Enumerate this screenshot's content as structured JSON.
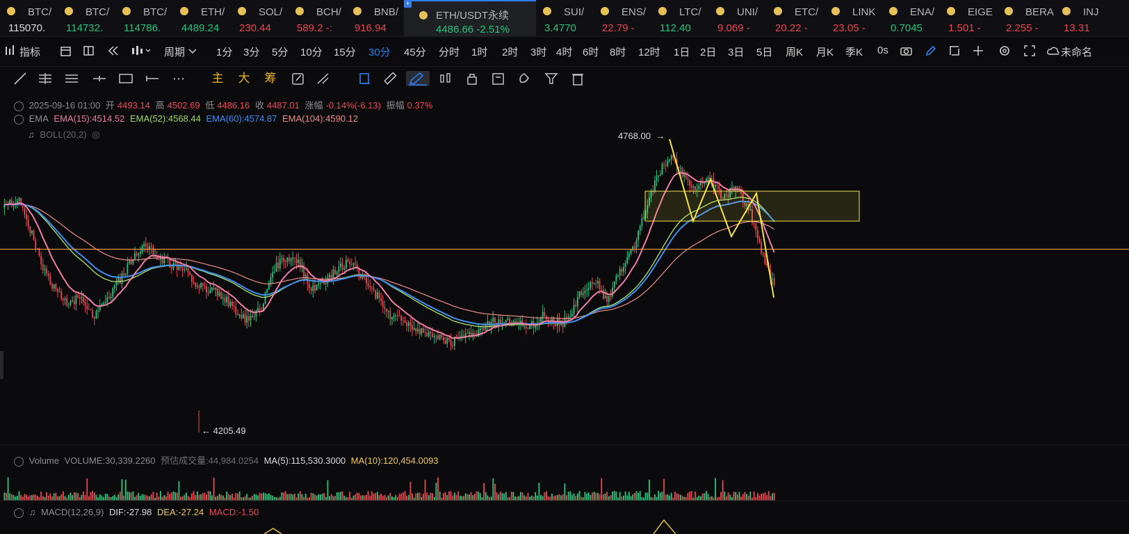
{
  "ticker": [
    {
      "sym": "BTC/",
      "price": "115070.",
      "cls": "wh"
    },
    {
      "sym": "BTC/",
      "price": "114732.",
      "cls": "up"
    },
    {
      "sym": "BTC/",
      "price": "114786.",
      "cls": "up"
    },
    {
      "sym": "ETH/",
      "price": "4489.24",
      "cls": "up"
    },
    {
      "sym": "SOL/",
      "price": "230.44",
      "cls": "dn"
    },
    {
      "sym": "BCH/",
      "price": "589.2 -:",
      "cls": "dn"
    },
    {
      "sym": "BNB/",
      "price": "916.94",
      "cls": "dn"
    },
    {
      "sym": "ETH/USDT永续",
      "price": "4486.66  -2.51%",
      "cls": "up",
      "active": true
    },
    {
      "sym": "SUI/",
      "price": "3.4770",
      "cls": "up"
    },
    {
      "sym": "ENS/",
      "price": "22.79 -",
      "cls": "dn"
    },
    {
      "sym": "LTC/",
      "price": "112.40",
      "cls": "up"
    },
    {
      "sym": "UNI/",
      "price": "9.069 -",
      "cls": "dn"
    },
    {
      "sym": "ETC/",
      "price": "20.22 -",
      "cls": "dn"
    },
    {
      "sym": "LINK",
      "price": "23.05 -",
      "cls": "dn"
    },
    {
      "sym": "ENA/",
      "price": "0.7045",
      "cls": "up"
    },
    {
      "sym": "EIGE",
      "price": "1.501 -",
      "cls": "dn"
    },
    {
      "sym": "BERA",
      "price": "2.255 -",
      "cls": "dn"
    },
    {
      "sym": "INJ",
      "price": "13.31",
      "cls": "dn"
    }
  ],
  "toolbar": {
    "indicators": "指标",
    "period": "周期",
    "intervals": [
      "1分",
      "3分",
      "5分",
      "10分",
      "15分",
      "30分",
      "45分",
      "分时",
      "1时",
      "2时",
      "3时",
      "4时",
      "6时",
      "8时",
      "12时",
      "1日",
      "2日",
      "3日",
      "5日",
      "周K",
      "月K",
      "季K"
    ],
    "selected": "30分",
    "countdown": "0s",
    "unnamed": "未命名"
  },
  "drawtools": {
    "main": "主",
    "big": "大",
    "chip": "筹"
  },
  "ohlc": {
    "date": "2025-09-16 01:00",
    "open_label": "开",
    "open": "4493.14",
    "high_label": "高",
    "high": "4502.69",
    "low_label": "低",
    "low": "4486.16",
    "close_label": "收",
    "close": "4487.01",
    "chg_label": "涨幅",
    "chg": "-0.14%(-6.13)",
    "amp_label": "振幅",
    "amp": "0.37%"
  },
  "ema": {
    "label": "EMA",
    "e15": "EMA(15):4514.52",
    "e52": "EMA(52):4568.44",
    "e60": "EMA(60):4574.87",
    "e104": "EMA(104):4590.12"
  },
  "boll": {
    "label": "BOLL(20,2)"
  },
  "annotations": {
    "high": "4768.00",
    "low": "4205.49"
  },
  "volume": {
    "label": "Volume",
    "vol": "VOLUME:30,339.2260",
    "est": "预估成交量:44,984.0254",
    "ma5": "MA(5):115,530.3000",
    "ma10": "MA(10):120,454.0093"
  },
  "macd": {
    "label": "MACD(12,26,9)",
    "dif": "DIF:-27.98",
    "dea": "DEA:-27.24",
    "macd": "MACD:-1.50"
  },
  "colors": {
    "up": "#29c37c",
    "down": "#e8474f",
    "accent": "#2f7df0",
    "ema15": "#f07ea7",
    "ema52": "#a3d86b",
    "ema60": "#3f8ff0",
    "ema104": "#ec8f8a",
    "drawing": "#f5e44a"
  },
  "chart_data": {
    "type": "candlestick",
    "symbol": "ETH/USDT永续",
    "interval": "30分",
    "ylim": [
      4205.49,
      4768.0
    ],
    "close_path": [
      4640,
      4660,
      4600,
      4520,
      4480,
      4450,
      4470,
      4430,
      4460,
      4500,
      4540,
      4570,
      4545,
      4530,
      4520,
      4490,
      4480,
      4470,
      4440,
      4420,
      4445,
      4520,
      4545,
      4530,
      4480,
      4500,
      4520,
      4540,
      4500,
      4470,
      4430,
      4420,
      4400,
      4395,
      4385,
      4380,
      4395,
      4400,
      4420,
      4415,
      4420,
      4410,
      4430,
      4415,
      4420,
      4480,
      4500,
      4460,
      4520,
      4560,
      4640,
      4710,
      4740,
      4700,
      4680,
      4695,
      4660,
      4680,
      4640,
      4560,
      4487
    ],
    "level_line": 4560
  }
}
